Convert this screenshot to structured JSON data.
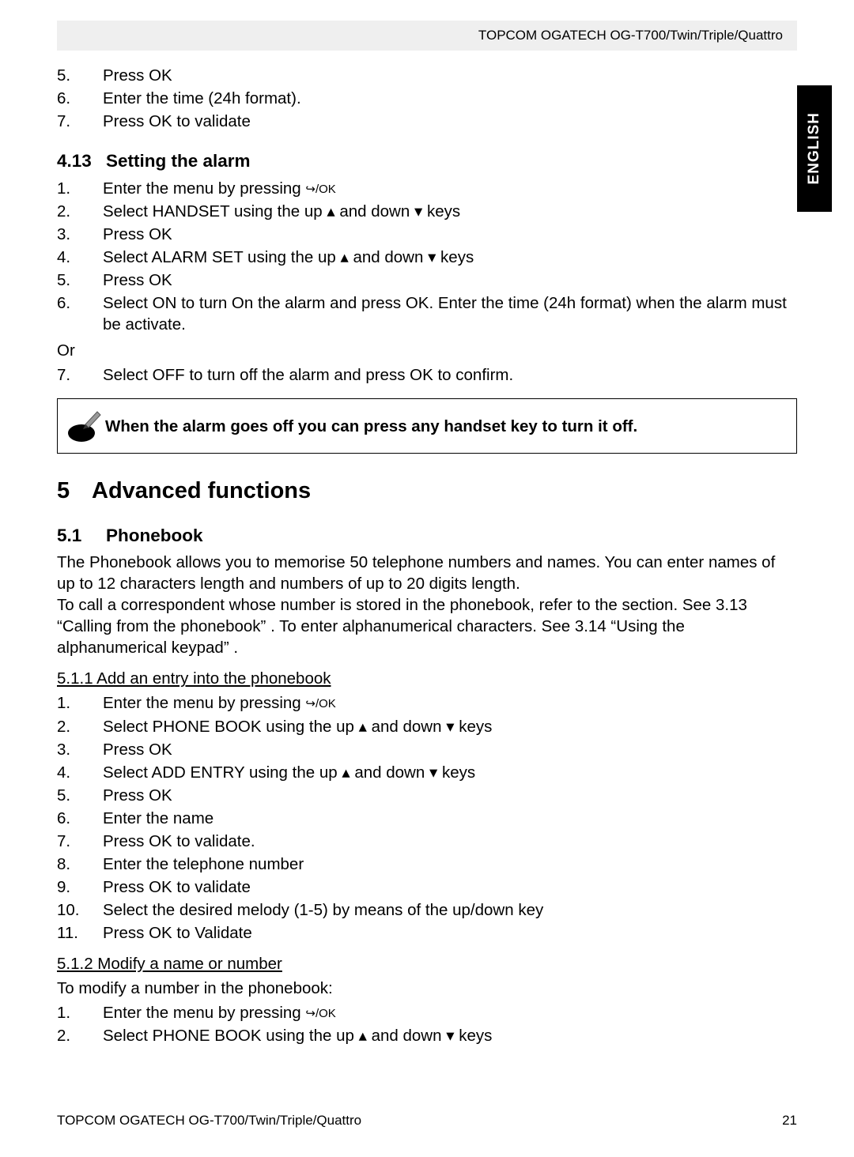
{
  "header": {
    "product_line": "TOPCOM OGATECH OG-T700/Twin/Triple/Quattro"
  },
  "side_tab": {
    "language": "ENGLISH"
  },
  "glyphs": {
    "ok": "↪/OK",
    "up": "▴",
    "down": "▾"
  },
  "cont_list": [
    {
      "n": "5.",
      "t": "Press OK"
    },
    {
      "n": "6.",
      "t": "Enter the time (24h format)."
    },
    {
      "n": "7.",
      "t": "Press OK to validate"
    }
  ],
  "sec413": {
    "num": "4.13",
    "title": "Setting the alarm",
    "steps_a": [
      {
        "n": "1.",
        "t_before": "Enter the menu by pressing  ",
        "g": "ok",
        "t_after": ""
      },
      {
        "n": "2.",
        "t_before": "Select HANDSET using the up ",
        "g2": true,
        "t_after": " keys"
      },
      {
        "n": "3.",
        "t_before": "Press OK"
      },
      {
        "n": "4.",
        "t_before": "Select ALARM SET using the up ",
        "g2": true,
        "t_after": " keys"
      },
      {
        "n": "5.",
        "t_before": "Press OK"
      },
      {
        "n": "6.",
        "t_before": "Select ON to turn On the alarm and press OK.  Enter the time (24h format) when the alarm must be activate."
      }
    ],
    "or": "Or",
    "steps_b": [
      {
        "n": "7.",
        "t_before": "Select OFF to turn off the alarm and press OK to confirm."
      }
    ]
  },
  "note": {
    "text": "When the alarm goes off you can press any handset key to turn it off."
  },
  "chapter5": {
    "num": "5",
    "title": "Advanced functions"
  },
  "sec51": {
    "num": "5.1",
    "title": "Phonebook",
    "para": "The Phonebook allows you to memorise 50 telephone numbers and names. You can enter names of up to 12 characters length and numbers of up to 20 digits length.\nTo call a correspondent whose number is stored in the phonebook, refer to the section. See 3.13 “Calling from the phonebook” . To enter alphanumerical characters. See 3.14 “Using the alphanumerical keypad” ."
  },
  "sec511": {
    "head": "5.1.1 Add an entry into    the phonebook  ",
    "steps": [
      {
        "n": "1.",
        "t_before": "Enter the menu by pressing  ",
        "g": "ok"
      },
      {
        "n": "2.",
        "t_before": "Select PHONE BOOK using the up ",
        "g2": true,
        "t_after": " keys"
      },
      {
        "n": "3.",
        "t_before": "Press OK"
      },
      {
        "n": "4.",
        "t_before": "Select ADD ENTRY using the up ",
        "g2": true,
        "t_after": " keys"
      },
      {
        "n": "5.",
        "t_before": "Press OK"
      },
      {
        "n": "6.",
        "t_before": "Enter the name"
      },
      {
        "n": "7.",
        "t_before": "Press OK to validate."
      },
      {
        "n": "8.",
        "t_before": "Enter the telephone number"
      },
      {
        "n": "9.",
        "t_before": "Press OK to validate"
      },
      {
        "n": "10.",
        "t_before": "Select the desired melody (1-5) by means of the up/down key"
      },
      {
        "n": "11.",
        "t_before": "Press OK to Validate"
      }
    ]
  },
  "sec512": {
    "head": "5.1.2 Modify a name or number   ",
    "intro": "To modify a number in the phonebook:",
    "steps": [
      {
        "n": "1.",
        "t_before": "Enter the menu by pressing  ",
        "g": "ok"
      },
      {
        "n": "2.",
        "t_before": "Select PHONE BOOK using the up ",
        "g2": true,
        "t_after": " keys"
      }
    ]
  },
  "footer": {
    "product_line": "TOPCOM OGATECH OG-T700/Twin/Triple/Quattro",
    "page_number": "21"
  }
}
